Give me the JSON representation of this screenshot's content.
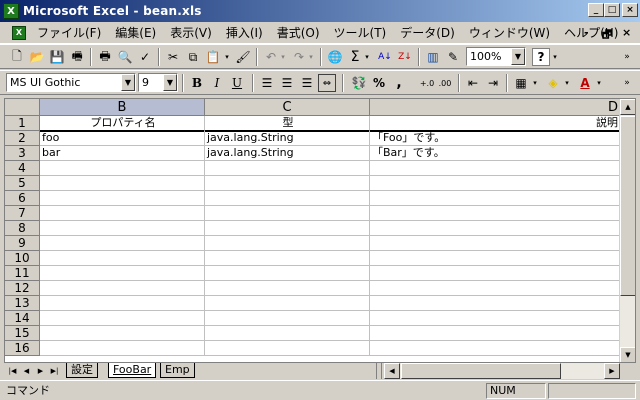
{
  "window": {
    "title": "Microsoft Excel - bean.xls",
    "app_icon": "X",
    "min_label": "_",
    "max_label": "□",
    "close_label": "×"
  },
  "menu": {
    "items": [
      "ファイル(F)",
      "編集(E)",
      "表示(V)",
      "挿入(I)",
      "書式(O)",
      "ツール(T)",
      "データ(D)",
      "ウィンドウ(W)",
      "ヘルプ(H)"
    ],
    "doc_min": "-",
    "doc_restore": "🗗",
    "doc_close": "×"
  },
  "toolbar": {
    "zoom": "100%",
    "help_label": "?"
  },
  "format": {
    "font": "MS UI Gothic",
    "size": "9",
    "bold": "B",
    "italic": "I",
    "underline": "U",
    "percent": "%",
    "comma": ","
  },
  "columns": [
    {
      "letter": "B",
      "selected": true
    },
    {
      "letter": "C",
      "selected": false
    },
    {
      "letter": "D",
      "selected": false
    }
  ],
  "rows": [
    "1",
    "2",
    "3",
    "4",
    "5",
    "6",
    "7",
    "8",
    "9",
    "10",
    "11",
    "12",
    "13",
    "14",
    "15",
    "16"
  ],
  "table": {
    "headers": [
      "プロパティ名",
      "型",
      "説明"
    ],
    "data": [
      [
        "foo",
        "java.lang.String",
        "「Foo」です。"
      ],
      [
        "bar",
        "java.lang.String",
        "「Bar」です。"
      ]
    ]
  },
  "tabs": [
    {
      "label": "設定",
      "active": false
    },
    {
      "label": "FooBar",
      "active": true
    },
    {
      "label": "Emp",
      "active": false
    }
  ],
  "status": {
    "mode": "コマンド",
    "num": "NUM"
  },
  "colors": {
    "title_start": "#0a246a",
    "title_end": "#a6caf0",
    "selected_header": "#b6bdd2",
    "excel_green": "#1e7b1e"
  }
}
